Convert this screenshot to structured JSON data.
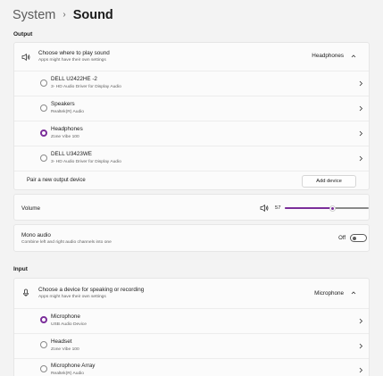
{
  "breadcrumb": {
    "parent": "System",
    "separator": "›",
    "current": "Sound"
  },
  "output": {
    "section_label": "Output",
    "choose": {
      "title": "Choose where to play sound",
      "subtitle": "Apps might have their own settings",
      "selected": "Headphones"
    },
    "devices": [
      {
        "name": "DELL U2422HE -2",
        "desc": "3- HD Audio Driver for Display Audio",
        "selected": false
      },
      {
        "name": "Speakers",
        "desc": "Realtek(R) Audio",
        "selected": false
      },
      {
        "name": "Headphones",
        "desc": "Zone Vibe 100",
        "selected": true
      },
      {
        "name": "DELL U3423WE",
        "desc": "3- HD Audio Driver for Display Audio",
        "selected": false
      }
    ],
    "pair": {
      "label": "Pair a new output device",
      "button": "Add device"
    },
    "volume": {
      "label": "Volume",
      "value": "57",
      "level": 57
    },
    "mono": {
      "title": "Mono audio",
      "subtitle": "Combine left and right audio channels into one",
      "state": "Off"
    }
  },
  "input": {
    "section_label": "Input",
    "choose": {
      "title": "Choose a device for speaking or recording",
      "subtitle": "Apps might have their own settings",
      "selected": "Microphone"
    },
    "devices": [
      {
        "name": "Microphone",
        "desc": "USB Audio Device",
        "selected": true
      },
      {
        "name": "Headset",
        "desc": "Zone Vibe 100",
        "selected": false
      },
      {
        "name": "Microphone Array",
        "desc": "Realtek(R) Audio",
        "selected": false
      }
    ]
  },
  "icons": {
    "speaker": "speaker-icon",
    "microphone": "microphone-icon",
    "chevron_up": "chevron-up-icon",
    "chevron_right": "chevron-right-icon"
  },
  "colors": {
    "accent": "#7b2e9a",
    "background": "#f3f3f3",
    "card": "#fbfbfb"
  }
}
